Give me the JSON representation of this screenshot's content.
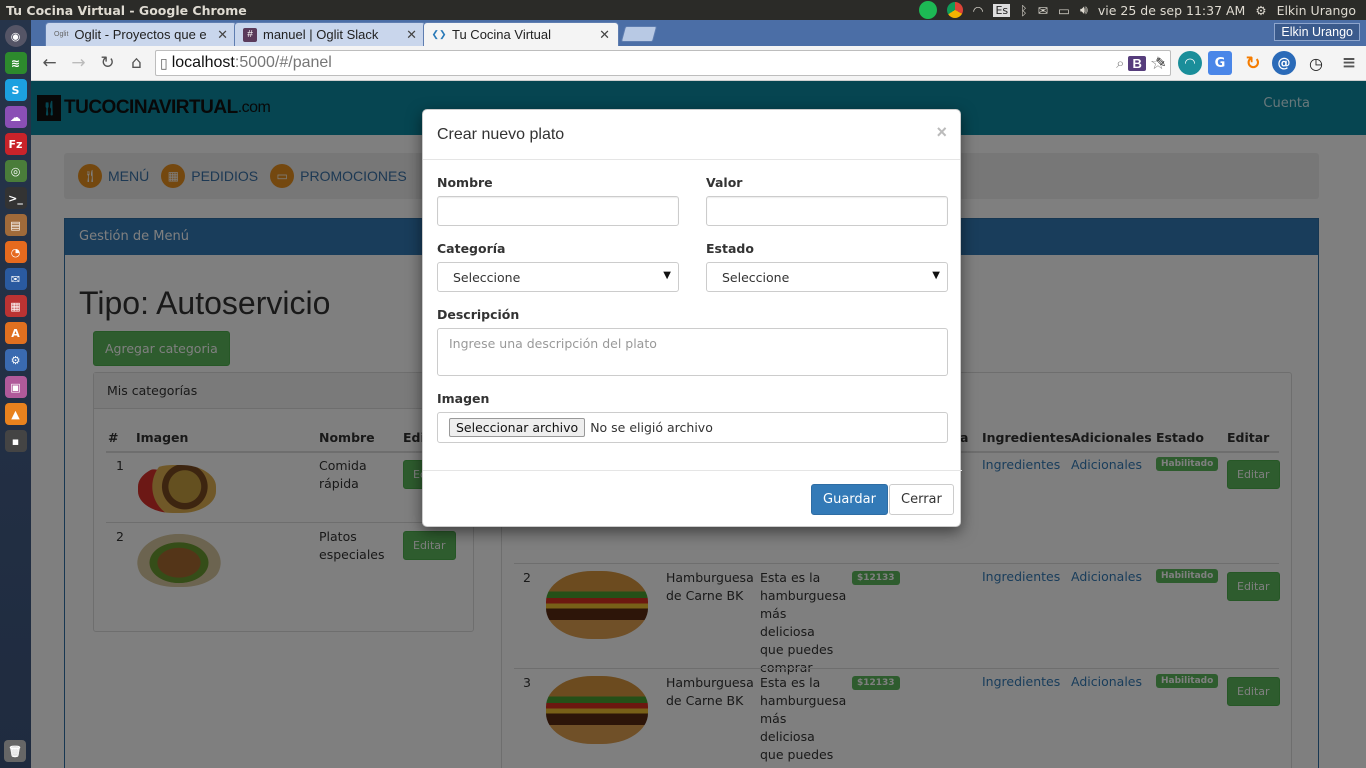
{
  "os": {
    "window_title": "Tu Cocina Virtual - Google Chrome",
    "datetime": "vie 25 de sep 11:37 AM",
    "user": "Elkin Urango",
    "keyboard_layout": "Es"
  },
  "browser": {
    "tabs": [
      {
        "label": "Oglit - Proyectos que e",
        "favicon": "Oglit"
      },
      {
        "label": "manuel | Oglit Slack",
        "favicon": "#"
      },
      {
        "label": "Tu Cocina Virtual",
        "favicon": "❮❯",
        "active": true
      }
    ],
    "profile_name": "Elkin Urango",
    "url_host": "localhost",
    "url_rest": ":5000/#/panel"
  },
  "app": {
    "logo_main": "TUCOCINAVIRTUAL",
    "logo_domain": ".com",
    "account_link": "Cuenta",
    "menu": [
      {
        "label": "MENÚ",
        "icon": "cutlery-icon"
      },
      {
        "label": "PEDIDIOS",
        "icon": "calendar-icon"
      },
      {
        "label": "PROMOCIONES",
        "icon": "ticket-icon"
      }
    ],
    "panel_heading": "Gestión de Menú",
    "page_title": "Tipo: Autoservicio",
    "add_category_label": "Agregar categoria",
    "categories_panel_title": "Mis categorías",
    "categories_columns": [
      "#",
      "Imagen",
      "Nombre",
      "Edit"
    ],
    "categories": [
      {
        "num": "1",
        "name": "Comida rápida",
        "edit": "Ed"
      },
      {
        "num": "2",
        "name": "Platos especiales",
        "edit": "Editar"
      }
    ],
    "plates_columns": [
      "a",
      "Ingredientes",
      "Adicionales",
      "Estado",
      "Editar"
    ],
    "plates": [
      {
        "num": "",
        "name": "",
        "desc": "",
        "price": "",
        "ingredients": "Ingredientes",
        "extras": "Adicionales",
        "status": "Habilitado",
        "edit": "Editar"
      },
      {
        "num": "2",
        "name": "Hamburguesa de Carne BK",
        "desc": "Esta es la hamburguesa más deliciosa que puedes comprar",
        "price": "$12133",
        "ingredients": "Ingredientes",
        "extras": "Adicionales",
        "status": "Habilitado",
        "edit": "Editar"
      },
      {
        "num": "3",
        "name": "Hamburguesa de Carne BK",
        "desc": "Esta es la hamburguesa más deliciosa que puedes comprar",
        "price": "$12133",
        "ingredients": "Ingredientes",
        "extras": "Adicionales",
        "status": "Habilitado",
        "edit": "Editar"
      }
    ]
  },
  "modal": {
    "title": "Crear nuevo plato",
    "close": "×",
    "nombre_label": "Nombre",
    "nombre_value": "",
    "valor_label": "Valor",
    "valor_value": "",
    "categoria_label": "Categoría",
    "categoria_selected": "Seleccione",
    "estado_label": "Estado",
    "estado_selected": "Seleccione",
    "descripcion_label": "Descripción",
    "descripcion_placeholder": "Ingrese una descripción del plato",
    "imagen_label": "Imagen",
    "file_button": "Seleccionar archivo",
    "file_status": "No se eligió archivo",
    "save_label": "Guardar",
    "close_label": "Cerrar"
  }
}
